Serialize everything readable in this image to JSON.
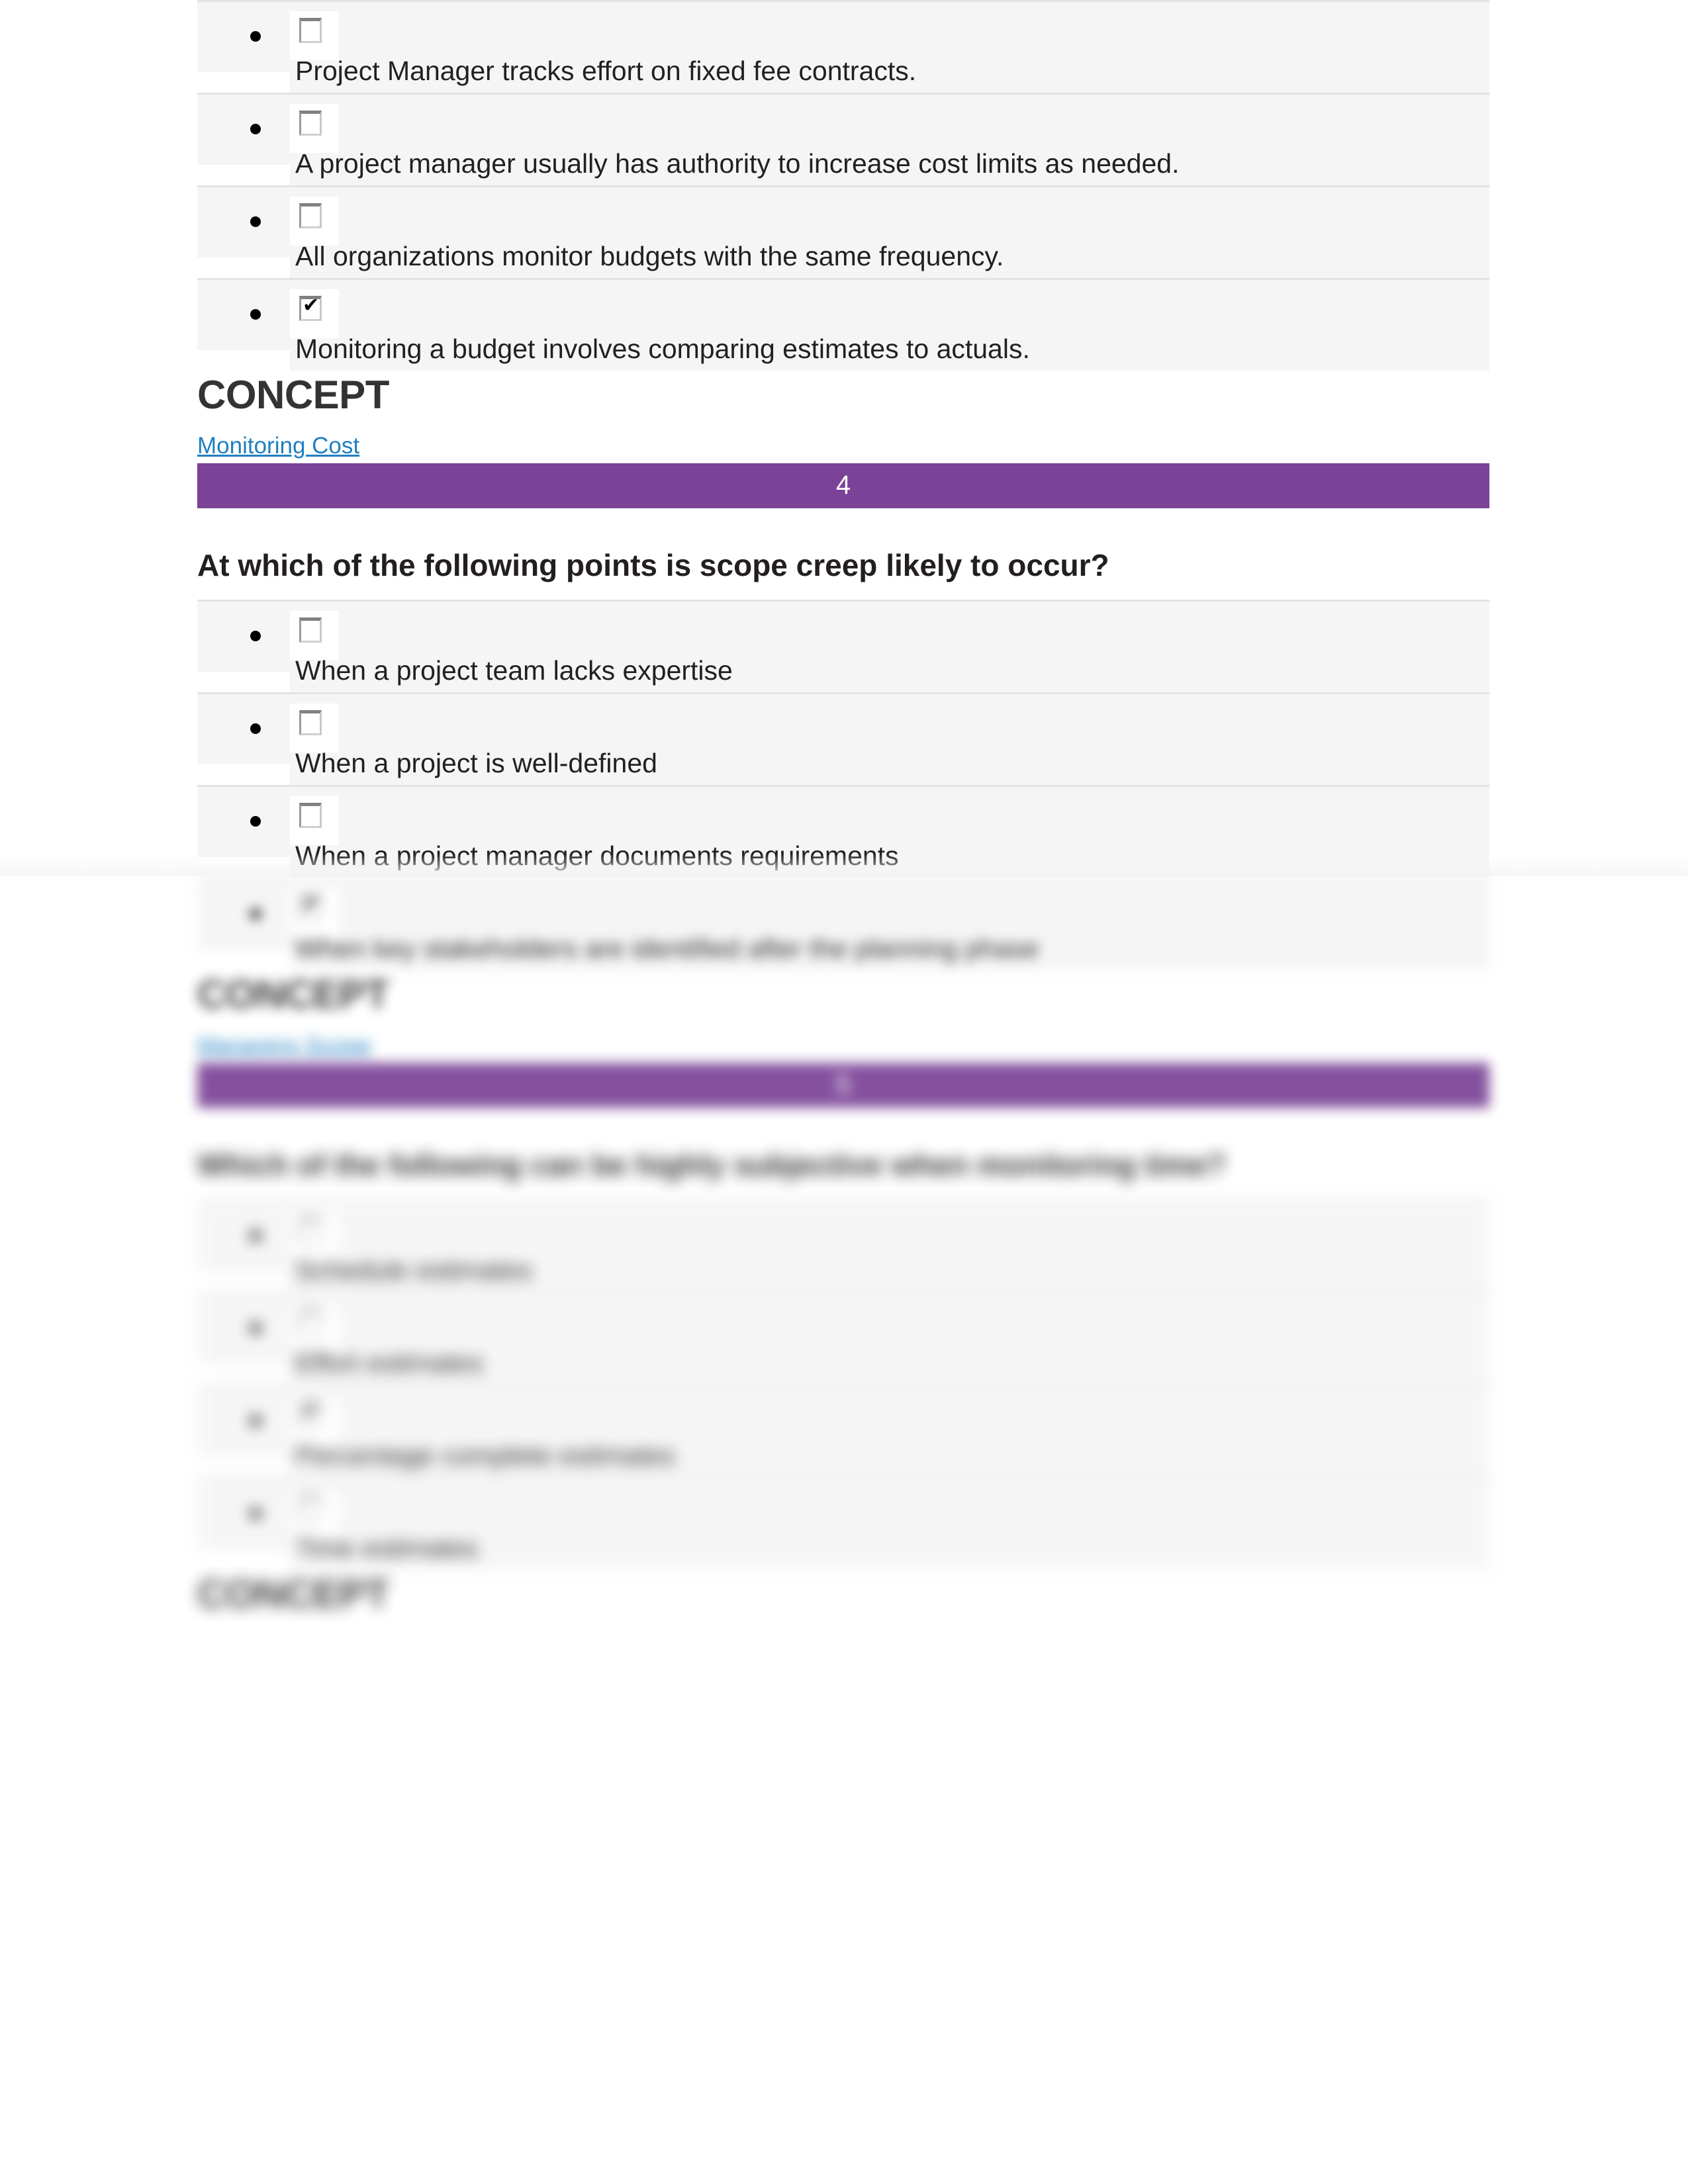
{
  "document": {
    "page_background": "#ffffff",
    "accent_purple": "#7b4397",
    "link_blue": "#1f7fc1",
    "row_background": "#f5f5f5"
  },
  "question_three_options": {
    "options": [
      {
        "label": "Project Manager tracks effort on fixed fee contracts.",
        "checked": false
      },
      {
        "label": "A project manager usually has authority to increase cost limits as needed.",
        "checked": false
      },
      {
        "label": "All organizations monitor budgets with the same frequency.",
        "checked": false
      },
      {
        "label": "Monitoring a budget involves comparing estimates to actuals.",
        "checked": true
      }
    ],
    "concept_heading": "CONCEPT",
    "concept_link": "Monitoring Cost"
  },
  "question_four": {
    "number": "4",
    "prompt": "At which of the following points is scope creep likely to occur?",
    "options": [
      {
        "label": "When a project team lacks expertise",
        "checked": false
      },
      {
        "label": "When a project is well-defined",
        "checked": false
      },
      {
        "label": "When a project manager documents requirements",
        "checked": false
      },
      {
        "label": "When key stakeholders are identified after the planning phase",
        "checked": true
      }
    ],
    "concept_heading": "CONCEPT",
    "concept_link": "Managing Scope"
  },
  "question_five": {
    "number": "5",
    "prompt": "Which of the following can be highly subjective when monitoring time?",
    "options": [
      {
        "label": "Schedule estimates",
        "checked": false
      },
      {
        "label": "Effort estimates",
        "checked": false
      },
      {
        "label": "Percentage complete estimates",
        "checked": true
      },
      {
        "label": "Time estimates",
        "checked": false
      }
    ],
    "concept_heading": "CONCEPT"
  }
}
